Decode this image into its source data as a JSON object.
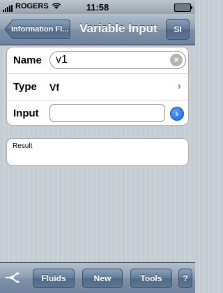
{
  "status_bar": {
    "carrier": "ROGERS",
    "time": "11:58"
  },
  "nav": {
    "back_label": "Information Fl...",
    "title": "Variable Input",
    "units_button": "SI"
  },
  "form": {
    "name_label": "Name",
    "name_value": "v1",
    "type_label": "Type",
    "type_value": "Vf",
    "input_label": "Input",
    "input_value": ""
  },
  "result": {
    "label": "Result"
  },
  "toolbar": {
    "fluids": "Fluids",
    "new": "New",
    "tools": "Tools",
    "help": "?"
  },
  "colors": {
    "nav_blue": "#6e839b",
    "go_button": "#1d5fd1"
  },
  "icons": {
    "clear": "clear-icon",
    "chevron": "chevron-right-icon",
    "go": "go-arrow-icon",
    "flow": "flow-diagram-icon"
  }
}
